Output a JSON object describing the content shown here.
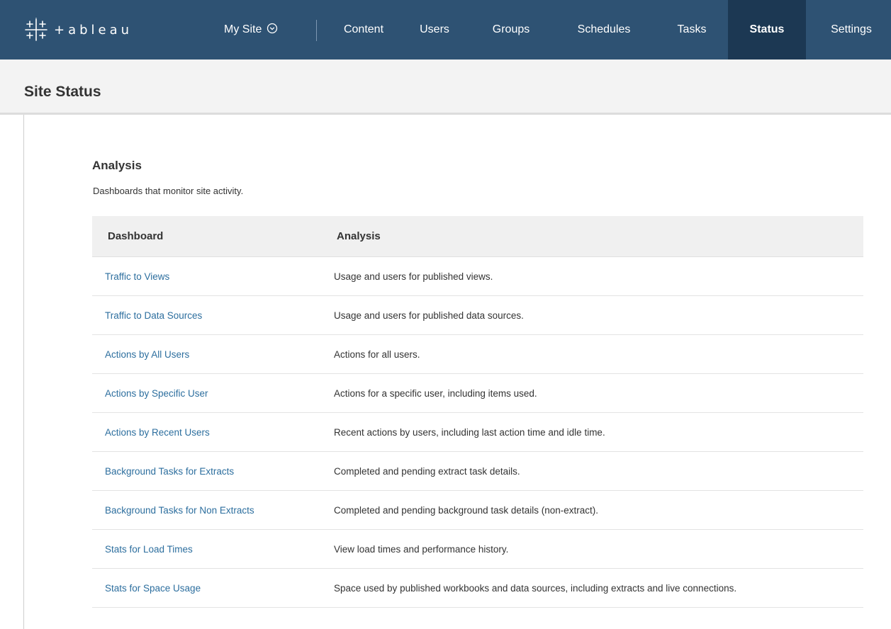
{
  "app": {
    "logo_text": "+ableau",
    "site_switch_label": "My Site"
  },
  "nav": {
    "items": [
      {
        "label": "Content"
      },
      {
        "label": "Users"
      },
      {
        "label": "Groups"
      },
      {
        "label": "Schedules"
      },
      {
        "label": "Tasks"
      },
      {
        "label": "Status",
        "active": true
      },
      {
        "label": "Settings"
      }
    ]
  },
  "page": {
    "title": "Site Status"
  },
  "section": {
    "title": "Analysis",
    "description": "Dashboards that monitor site activity."
  },
  "table": {
    "headers": [
      "Dashboard",
      "Analysis"
    ],
    "rows": [
      {
        "dashboard": "Traffic to Views",
        "analysis": "Usage and users for published views."
      },
      {
        "dashboard": "Traffic to Data Sources",
        "analysis": "Usage and users for published data sources."
      },
      {
        "dashboard": "Actions by All Users",
        "analysis": "Actions for all users."
      },
      {
        "dashboard": "Actions by Specific User",
        "analysis": "Actions for a specific user, including items used."
      },
      {
        "dashboard": "Actions by Recent Users",
        "analysis": "Recent actions by users, including last action time and idle time."
      },
      {
        "dashboard": "Background Tasks for Extracts",
        "analysis": "Completed and pending extract task details."
      },
      {
        "dashboard": "Background Tasks for Non Extracts",
        "analysis": "Completed and pending background task details (non-extract)."
      },
      {
        "dashboard": "Stats for Load Times",
        "analysis": "View load times and performance history."
      },
      {
        "dashboard": "Stats for Space Usage",
        "analysis": "Space used by published workbooks and data sources, including extracts and live connections."
      }
    ]
  },
  "colors": {
    "topbar": "#2e5273",
    "nav_active": "#1c3853",
    "link": "#2c6e9e",
    "header_bg": "#f3f3f3"
  },
  "icons": {
    "logo": "tableau-cross-logo-icon",
    "site_switch": "chevron-circle-down-icon"
  }
}
